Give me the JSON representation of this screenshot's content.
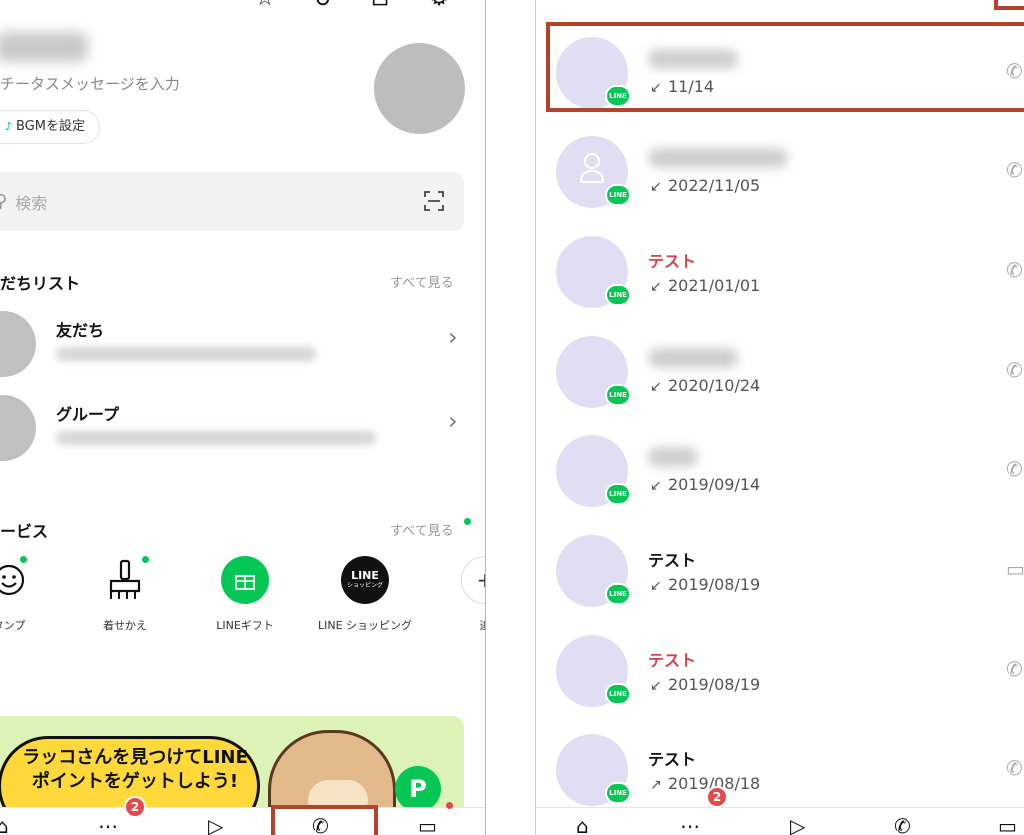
{
  "left": {
    "status_message": "チータスメッセージを入力",
    "bgm_button": "BGMを設定",
    "search_placeholder": "検索",
    "friends_section": {
      "title": "だちリスト",
      "see_all": "すべて見る"
    },
    "friend_rows": [
      {
        "title": "友だち"
      },
      {
        "title": "グループ"
      }
    ],
    "services_section": {
      "title": "ービス",
      "see_all": "すべて見る"
    },
    "services": [
      {
        "label": "タンプ",
        "icon": "sticker-icon"
      },
      {
        "label": "着せかえ",
        "icon": "brush-icon"
      },
      {
        "label": "LINEギフト",
        "icon": "gift-icon"
      },
      {
        "label": "LINE ショッピング",
        "icon": "line-shopping-icon",
        "icon_text": "LINE",
        "icon_subtext": "ショッピング"
      },
      {
        "label": "追",
        "icon": "add-icon"
      }
    ],
    "banner": {
      "text": "ラッコさんを見つけてLINEポイントをゲットしよう!",
      "badge": "P"
    },
    "tabbar": {
      "chat_badge": "2"
    }
  },
  "right": {
    "calls": [
      {
        "name": "",
        "date": "11/14",
        "direction": "incoming",
        "highlighted": true
      },
      {
        "name": "",
        "date": "2022/11/05",
        "direction": "incoming",
        "default_avatar": true
      },
      {
        "name": "テスト",
        "date": "2021/01/01",
        "direction": "incoming",
        "missed": true
      },
      {
        "name": "",
        "date": "2020/10/24",
        "direction": "incoming"
      },
      {
        "name": "",
        "date": "2019/09/14",
        "direction": "incoming"
      },
      {
        "name": "テスト",
        "date": "2019/08/19",
        "direction": "incoming",
        "video": true
      },
      {
        "name": "テスト",
        "date": "2019/08/19",
        "direction": "incoming",
        "missed": true
      },
      {
        "name": "テスト",
        "date": "2019/08/18",
        "direction": "outgoing"
      }
    ],
    "line_badge": "LINE",
    "tabbar": {
      "chat_badge": "2"
    }
  },
  "colors": {
    "line_green": "#06c755",
    "missed_red": "#d9434a",
    "highlight": "#b3432b",
    "avatar_lavender": "#e1def3"
  }
}
